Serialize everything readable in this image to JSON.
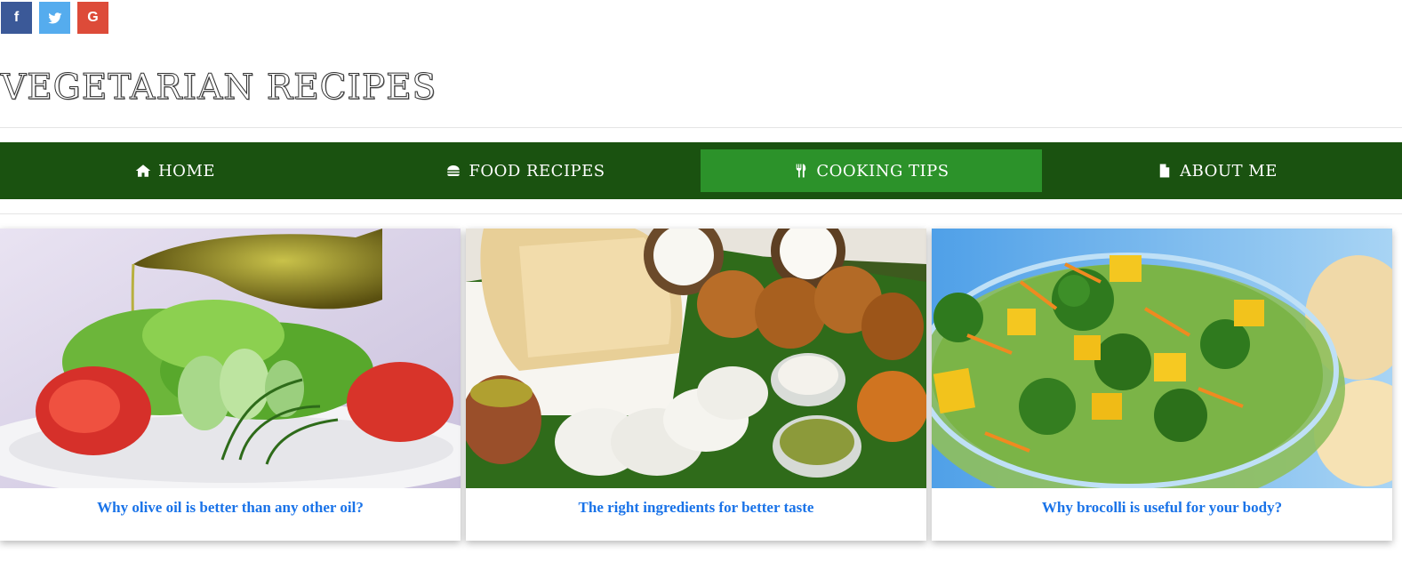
{
  "social": [
    {
      "icon": "facebook-icon",
      "glyph": "f"
    },
    {
      "icon": "twitter-icon",
      "glyph": ""
    },
    {
      "icon": "google-icon",
      "glyph": "G"
    }
  ],
  "site_title": "Vegetarian Recipes",
  "nav": {
    "items": [
      {
        "label": "Home",
        "icon": "home-icon"
      },
      {
        "label": "Food Recipes",
        "icon": "burger-icon"
      },
      {
        "label": "Cooking Tips",
        "icon": "cutlery-icon",
        "active": true
      },
      {
        "label": "About Me",
        "icon": "document-icon"
      }
    ]
  },
  "cards": [
    {
      "title": "Why olive oil is better than any other oil?",
      "image": "olive-oil-salad-image"
    },
    {
      "title": "The right ingredients for better taste",
      "image": "dosa-idli-platter-image"
    },
    {
      "title": "Why brocolli is useful for your body?",
      "image": "broccoli-salad-bowl-image"
    }
  ],
  "colors": {
    "nav_bg": "#1a5210",
    "nav_active": "#2c922a",
    "link": "#1a73e8",
    "facebook": "#3b5998",
    "twitter": "#55acee",
    "google": "#dd4b39"
  }
}
